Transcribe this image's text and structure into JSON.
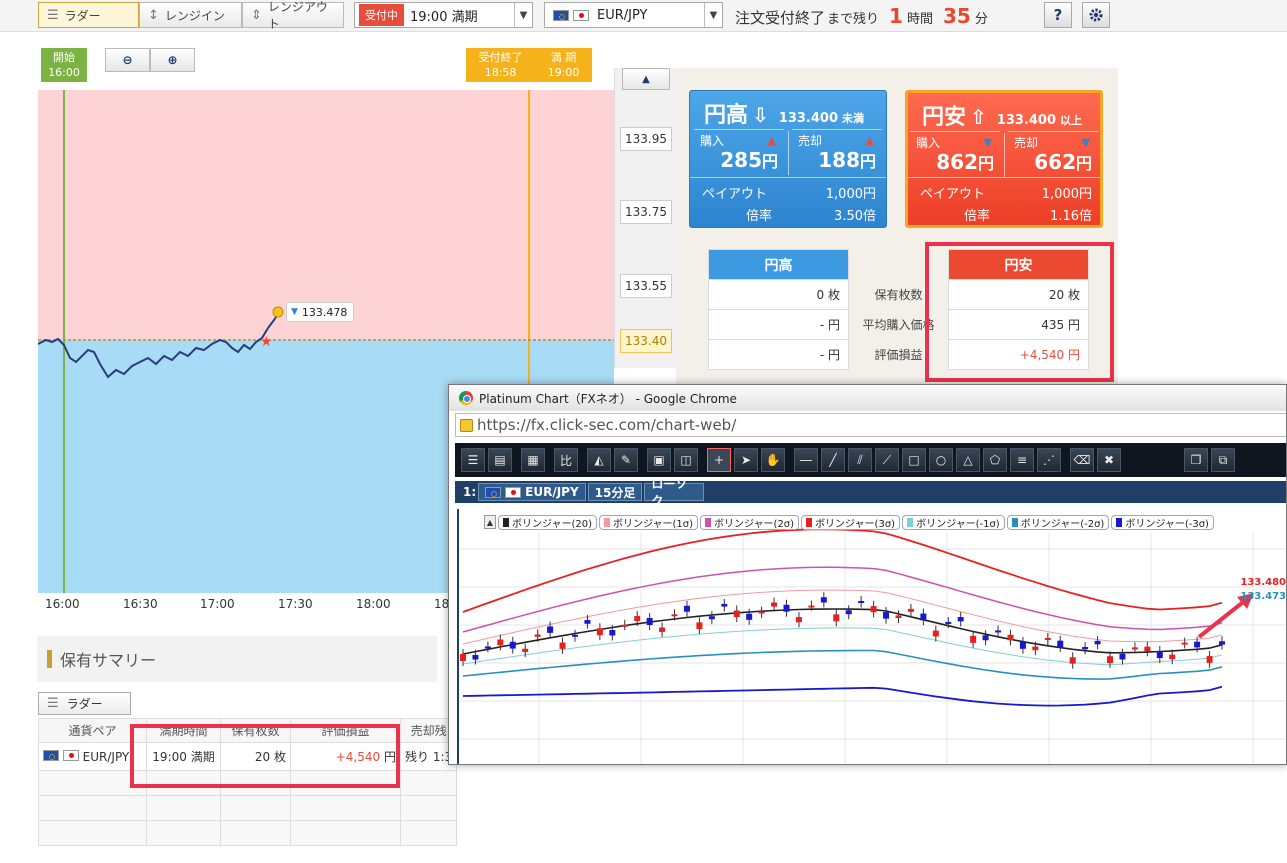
{
  "topbar": {
    "tabs": [
      {
        "label": "ラダー",
        "icon": "ladder-icon",
        "active": true
      },
      {
        "label": "レンジイン",
        "icon": "range-in-icon",
        "active": false
      },
      {
        "label": "レンジアウト",
        "icon": "range-out-icon",
        "active": false
      }
    ],
    "session": {
      "badge": "受付中",
      "value": "19:00 満期"
    },
    "pair": {
      "value": "EUR/JPY"
    },
    "remaining": {
      "prefix": "注文受付終了",
      "middle": "まで残り",
      "hours": "1",
      "hours_unit": "時間",
      "minutes": "35",
      "minutes_unit": "分"
    },
    "help_label": "?",
    "settings_icon": "gear-icon"
  },
  "chart": {
    "start_tag": {
      "line1": "開始",
      "line2": "16:00"
    },
    "end_tag": {
      "a1": "受付終了",
      "a2": "18:58",
      "b1": "満 期",
      "b2": "19:00"
    },
    "x_labels": [
      "16:00",
      "16:30",
      "17:00",
      "17:30",
      "18:00",
      "18"
    ],
    "price_scale": [
      "133.95",
      "133.75",
      "133.55",
      "133.40"
    ],
    "current_price_label": "133.478",
    "strike": "133.40",
    "colors": {
      "above": "#fdd3d6",
      "below": "#a8dcf6",
      "line": "#2b3c7a",
      "start": "#7cb342",
      "end": "#f6b21b"
    }
  },
  "cards": {
    "high": {
      "title": "円高",
      "threshold": "133.400",
      "threshold_suffix": "未満",
      "buy_label": "購入",
      "buy_value": "285",
      "sell_label": "売却",
      "sell_value": "188",
      "yen": "円",
      "payout_label": "ペイアウト",
      "payout_value": "1,000円",
      "ratio_label": "倍率",
      "ratio_value": "3.50倍"
    },
    "low": {
      "title": "円安",
      "threshold": "133.400",
      "threshold_suffix": "以上",
      "buy_label": "購入",
      "buy_value": "862",
      "sell_label": "売却",
      "sell_value": "662",
      "yen": "円",
      "payout_label": "ペイアウト",
      "payout_value": "1,000円",
      "ratio_label": "倍率",
      "ratio_value": "1.16倍"
    }
  },
  "holdings": {
    "col_high": "円高",
    "col_low": "円安",
    "rows": [
      {
        "label": "保有枚数",
        "high": "0 枚",
        "low": "20 枚"
      },
      {
        "label": "平均購入価格",
        "high": "- 円",
        "low": "435 円"
      },
      {
        "label": "評価損益",
        "high": "- 円",
        "low": "+4,540 円"
      }
    ]
  },
  "summary": {
    "title": "保有サマリー",
    "tab": "ラダー",
    "headers": [
      "通貨ペア",
      "満期時間",
      "保有枚数",
      "評価損益",
      "売却残"
    ],
    "row": {
      "pair": "EUR/JPY",
      "expiry": "19:00 満期",
      "qty": "20 枚",
      "pnl": "+4,540",
      "pnl_unit": "円",
      "remain": "残り 1:3"
    }
  },
  "popup": {
    "title": "Platinum Chart（FXネオ） - Google Chrome",
    "url": "https://fx.click-sec.com/chart-web/",
    "tab": {
      "index": "1:",
      "pair": "EUR/JPY",
      "timeframe": "15分足",
      "type": "ローソク"
    },
    "legend": [
      {
        "label": "ボリンジャー(20)",
        "color": "#222222"
      },
      {
        "label": "ボリンジャー(1σ)",
        "color": "#f29aa0"
      },
      {
        "label": "ボリンジャー(2σ)",
        "color": "#d050b0"
      },
      {
        "label": "ボリンジャー(3σ)",
        "color": "#e82020"
      },
      {
        "label": "ボリンジャー(-1σ)",
        "color": "#80d0d8"
      },
      {
        "label": "ボリンジャー(-2σ)",
        "color": "#2890c0"
      },
      {
        "label": "ボリンジャー(-3σ)",
        "color": "#1818d0"
      }
    ],
    "price_labels": [
      "133.480",
      "133.473"
    ]
  }
}
